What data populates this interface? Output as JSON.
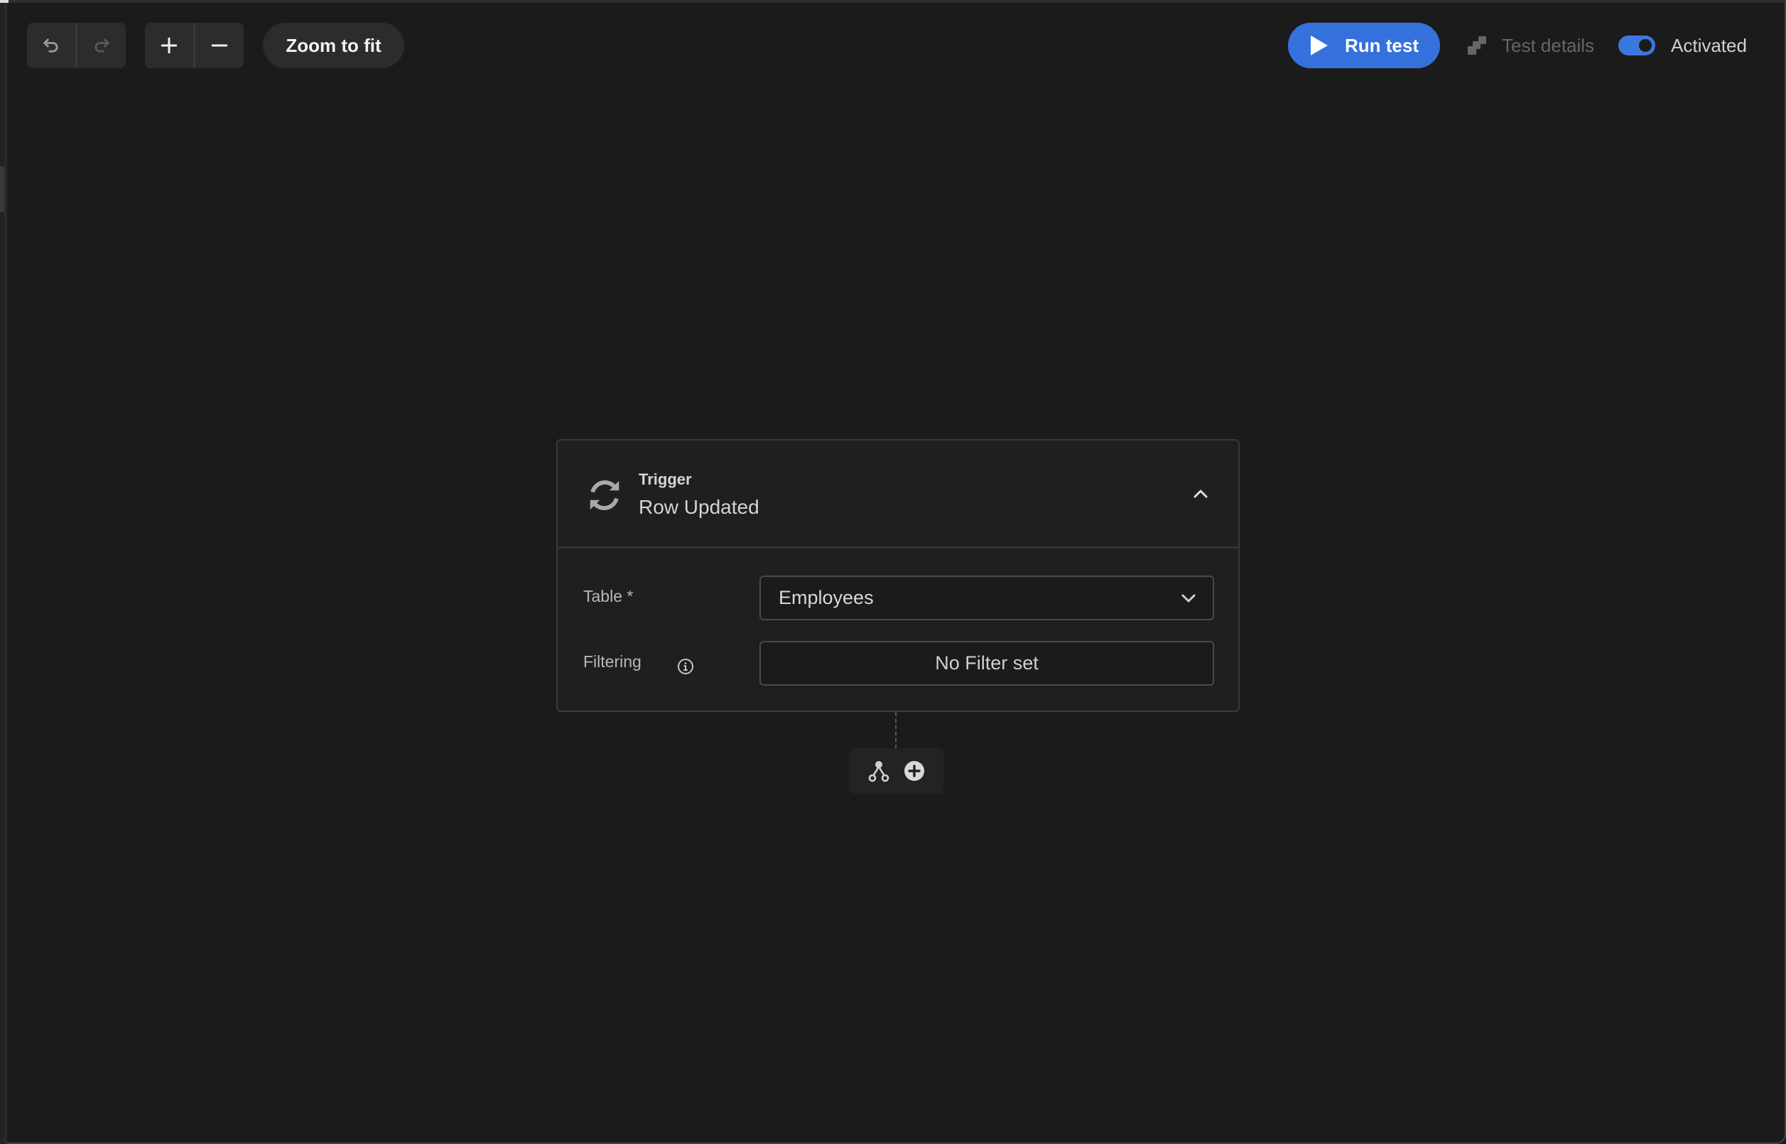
{
  "toolbar": {
    "undo_icon": "undo-icon",
    "redo_icon": "redo-icon",
    "zoom_in_icon": "plus-icon",
    "zoom_out_icon": "minus-icon",
    "zoom_to_fit_label": "Zoom to fit",
    "run_test_label": "Run test",
    "test_details_label": "Test details",
    "activated_label": "Activated",
    "activated": true,
    "accent_color": "#3571dd"
  },
  "trigger_card": {
    "kicker": "Trigger",
    "title": "Row Updated",
    "icon": "refresh-icon",
    "expanded": true,
    "fields": {
      "table_label": "Table *",
      "table_value": "Employees",
      "filtering_label": "Filtering",
      "filter_button_label": "No Filter set"
    }
  },
  "flow_actions": {
    "branch_icon": "branch-icon",
    "add_icon": "add-step-icon"
  }
}
